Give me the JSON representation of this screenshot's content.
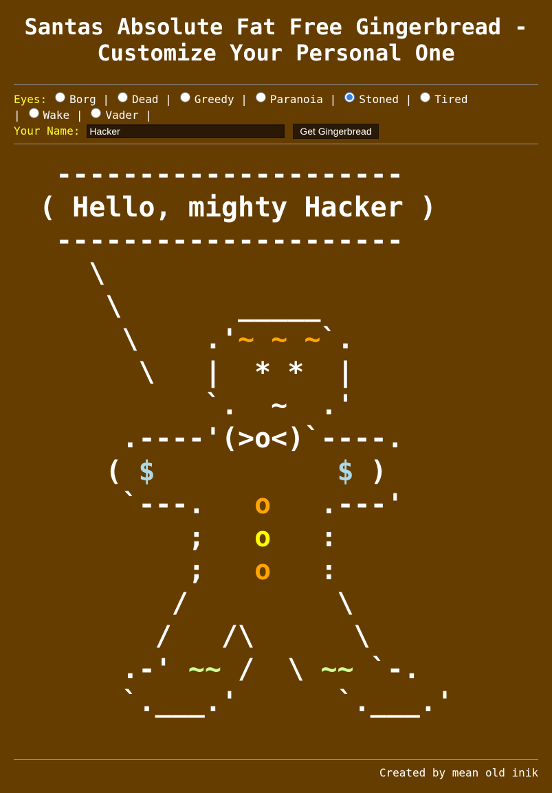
{
  "header": {
    "title": "Santas Absolute Fat Free Gingerbread - Customize Your Personal One"
  },
  "form": {
    "eyes_label": "Eyes:",
    "eye_options": [
      "Borg",
      "Dead",
      "Greedy",
      "Paranoia",
      "Stoned",
      "Tired",
      "Wake",
      "Vader"
    ],
    "selected_eyes": "Stoned",
    "separator": "|",
    "name_label": "Your Name:",
    "name_value": "Hacker",
    "submit_label": "Get Gingerbread"
  },
  "art": {
    "greeting_prefix": "( Hello, mighty ",
    "greeting_name": "Hacker",
    "greeting_suffix": " )",
    "dash_line": "---------------------",
    "eyes": "* *",
    "hair": "~ ~ ~",
    "mouth": "~",
    "nose": "(>o<)",
    "hand_symbol": "$",
    "button": "o",
    "feet": "~~"
  },
  "colors": {
    "background": "#663d00",
    "label": "#ffff33",
    "hair": "#ffa500",
    "hands": "#add8e6",
    "feet": "#ccff99",
    "button_top": "#ffa500",
    "button_middle": "#ffff00",
    "button_bottom": "#ffa500",
    "divider": "#8a9aa8"
  },
  "footer": {
    "credit": "Created by mean old inik"
  }
}
